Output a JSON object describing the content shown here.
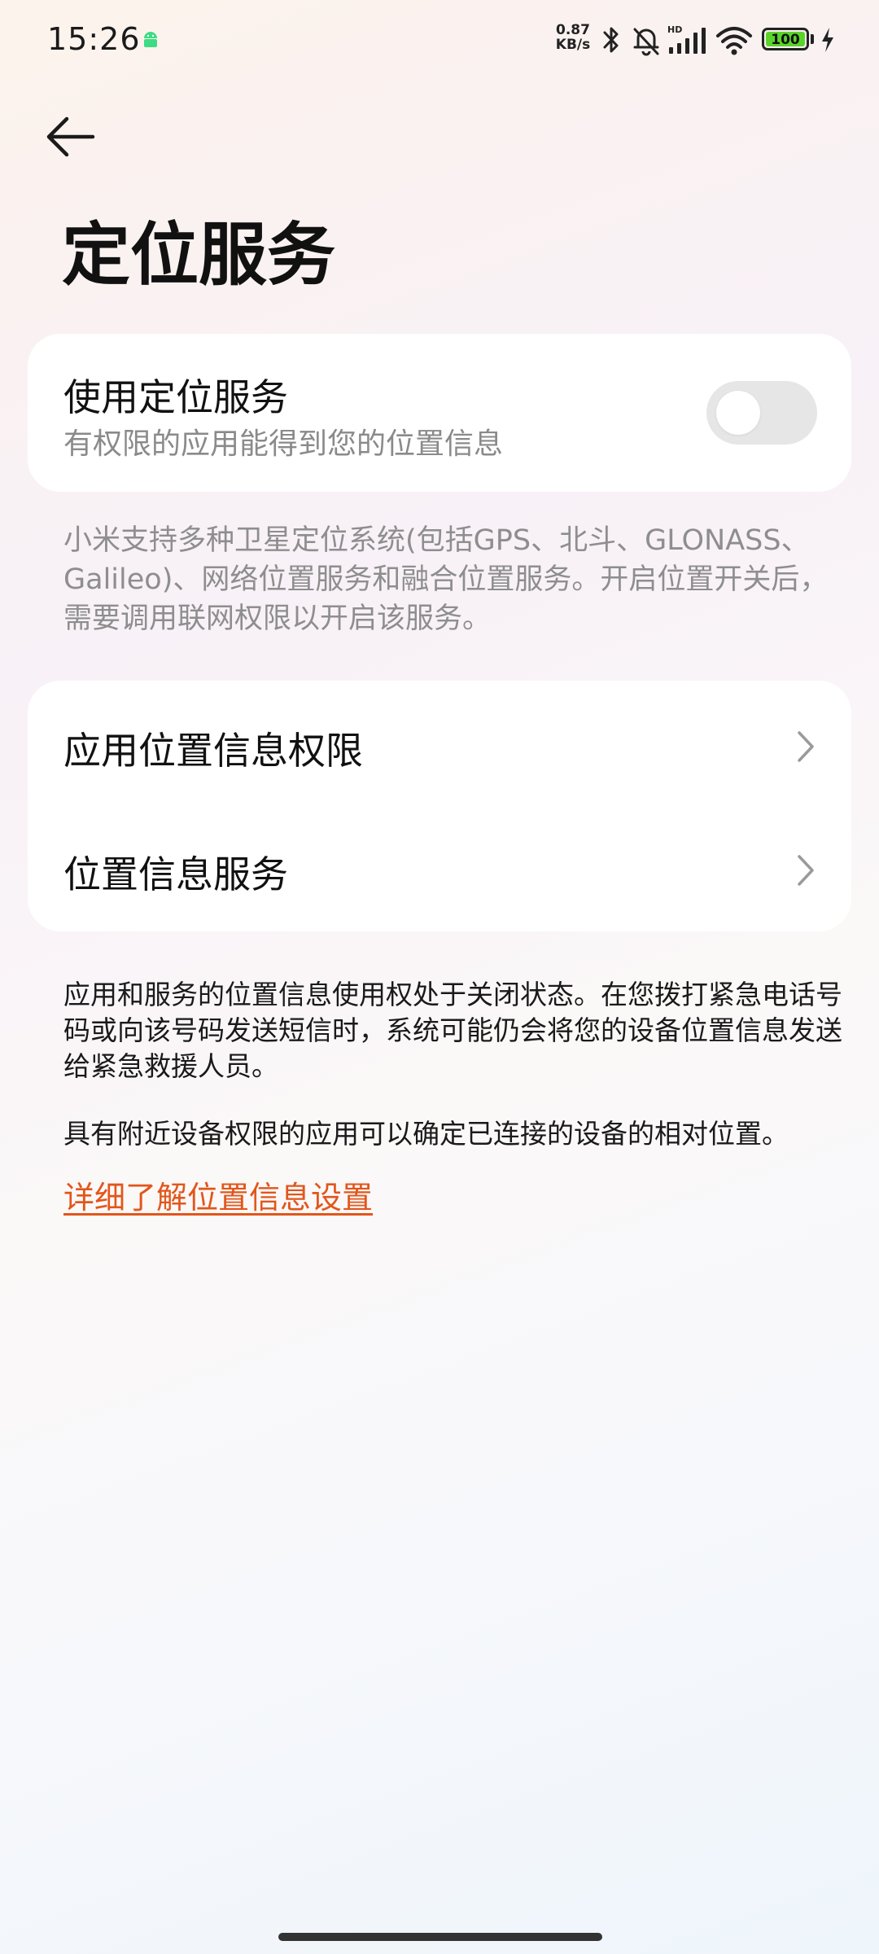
{
  "status_bar": {
    "time": "15:26",
    "net_speed_value": "0.87",
    "net_speed_unit": "KB/s",
    "signal_label": "HD",
    "battery_level": "100"
  },
  "header": {
    "title": "定位服务"
  },
  "location_card": {
    "title": "使用定位服务",
    "subtitle": "有权限的应用能得到您的位置信息",
    "toggle_on": false
  },
  "description": "小米支持多种卫星定位系统(包括GPS、北斗、GLONASS、Galileo)、网络位置服务和融合位置服务。开启位置开关后，需要调用联网权限以开启该服务。",
  "menu": {
    "items": [
      {
        "label": "应用位置信息权限",
        "icon": "chevron-right-icon"
      },
      {
        "label": "位置信息服务",
        "icon": "chevron-right-icon"
      }
    ]
  },
  "notes": {
    "emergency": "应用和服务的位置信息使用权处于关闭状态。在您拨打紧急电话号码或向该号码发送短信时，系统可能仍会将您的设备位置信息发送给紧急救援人员。",
    "nearby": "具有附近设备权限的应用可以确定已连接的设备的相对位置。",
    "learn_more": "详细了解位置信息设置"
  },
  "colors": {
    "link": "#e2561b",
    "battery": "#5bd42a",
    "toggle_off": "#e6e6e6"
  }
}
